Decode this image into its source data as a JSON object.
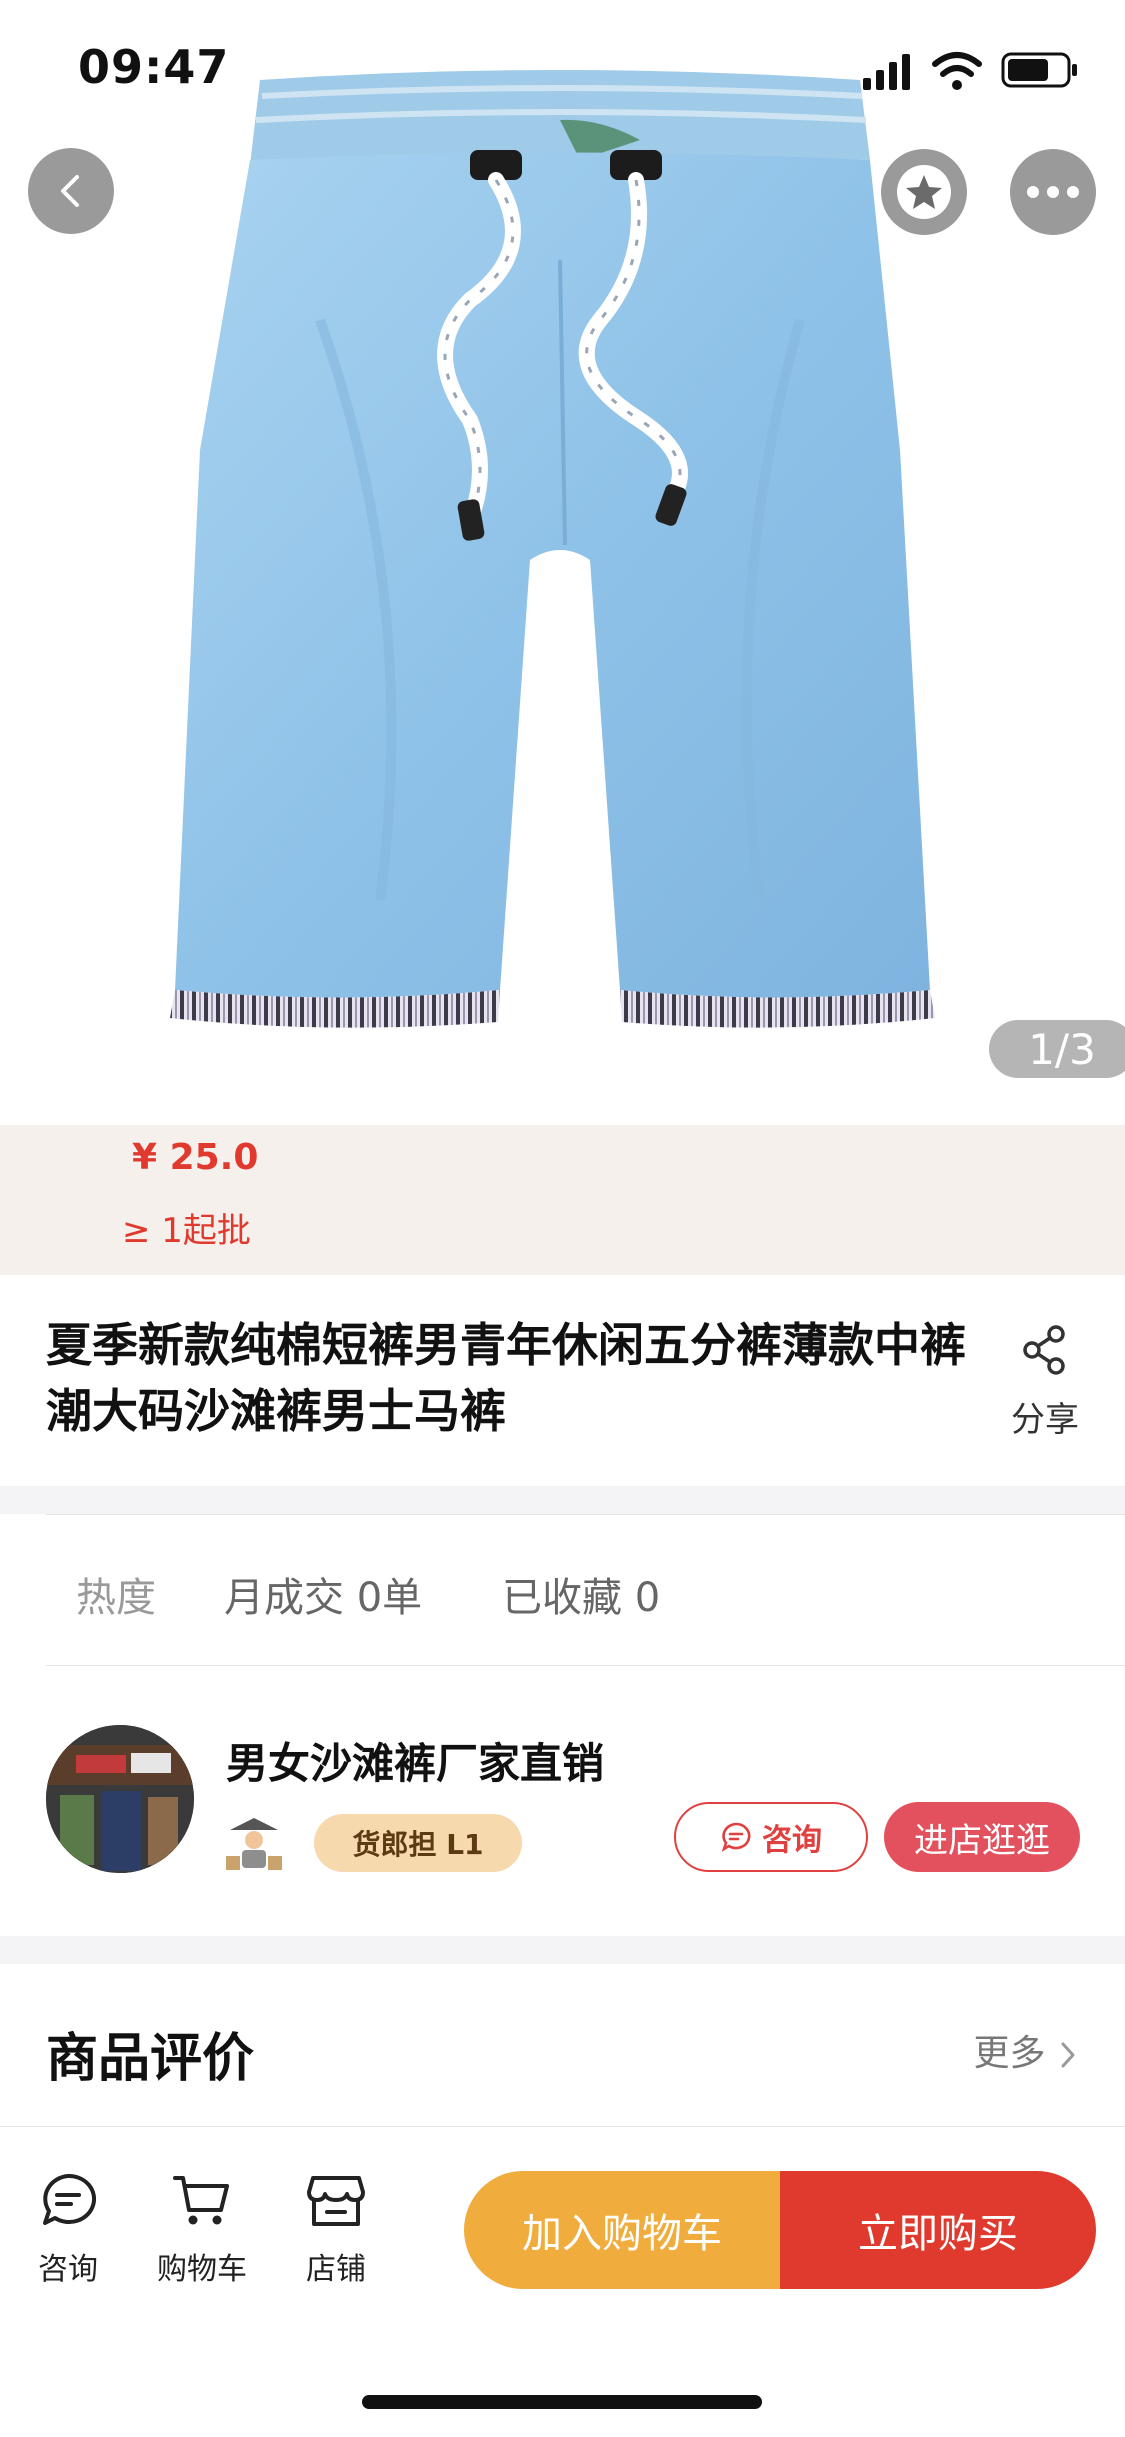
{
  "status_bar": {
    "time": "09:47"
  },
  "hero": {
    "image_counter": "1/3",
    "icons": [
      "back-icon",
      "star-icon",
      "more-icon"
    ]
  },
  "price_section": {
    "price": "¥ 25.0",
    "min_order": "≥ 1起批"
  },
  "product": {
    "title": "夏季新款纯棉短裤男青年休闲五分裤薄款中裤潮大码沙滩裤男士马裤",
    "share_label": "分享"
  },
  "stats": {
    "hot_label": "热度",
    "monthly_sales": "月成交 0单",
    "collected": "已收藏 0"
  },
  "shop": {
    "name": "男女沙滩裤厂家直销",
    "level_badge": "货郎担 L1",
    "consult_label": "咨询",
    "enter_label": "进店逛逛"
  },
  "reviews": {
    "title": "商品评价",
    "more_label": "更多"
  },
  "bottom_bar": {
    "tabs": [
      {
        "label": "咨询",
        "icon": "chat-icon"
      },
      {
        "label": "购物车",
        "icon": "cart-icon"
      },
      {
        "label": "店铺",
        "icon": "store-icon"
      }
    ],
    "add_to_cart_label": "加入购物车",
    "buy_now_label": "立即购买"
  },
  "colors": {
    "accent_red": "#e03a2f",
    "accent_orange": "#f0ac3c",
    "shop_button": "#e3515e",
    "price_band_bg": "#f6f0ec",
    "badge_bg": "#f6d9ad"
  }
}
